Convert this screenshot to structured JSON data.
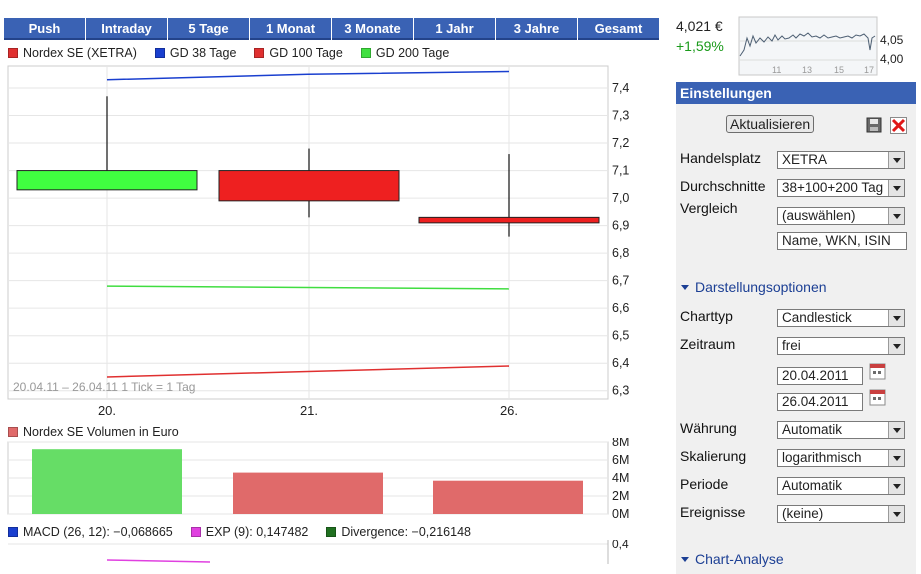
{
  "tabs": [
    "Push",
    "Intraday",
    "5 Tage",
    "1 Monat",
    "3 Monate",
    "1 Jahr",
    "3 Jahre",
    "Gesamt"
  ],
  "legend_main": [
    {
      "label": "Nordex SE (XETRA)",
      "color": "#e03030"
    },
    {
      "label": "GD 38 Tage",
      "color": "#1a3fcf"
    },
    {
      "label": "GD 100 Tage",
      "color": "#e03030"
    },
    {
      "label": "GD 200 Tage",
      "color": "#40e040"
    }
  ],
  "chart_data": [
    {
      "type": "candlestick",
      "series_name": "Nordex SE (XETRA)",
      "x": [
        "20.",
        "21.",
        "26."
      ],
      "candles": [
        {
          "open": 7.03,
          "high": 7.37,
          "low": 7.1,
          "close": 7.1,
          "color": "#40ff40"
        },
        {
          "open": 7.1,
          "high": 7.18,
          "low": 6.93,
          "close": 6.99,
          "color": "#ee2020"
        },
        {
          "open": 6.93,
          "high": 7.16,
          "low": 6.86,
          "close": 6.91,
          "color": "#ee2020"
        }
      ],
      "overlays": [
        {
          "name": "GD 38 Tage",
          "color": "#1a3fcf",
          "y": [
            7.43,
            7.45,
            7.46
          ]
        },
        {
          "name": "GD 100 Tage",
          "color": "#e03030",
          "y": [
            6.35,
            6.37,
            6.39
          ]
        },
        {
          "name": "GD 200 Tage",
          "color": "#40dd40",
          "y": [
            6.68,
            6.675,
            6.67
          ]
        }
      ],
      "yticks": [
        "7,4",
        "7,3",
        "7,2",
        "7,1",
        "7,0",
        "6,9",
        "6,8",
        "6,7",
        "6,6",
        "6,5",
        "6,4",
        "6,3"
      ],
      "ylim": [
        6.27,
        7.48
      ],
      "y_scale": "logarithmic",
      "grid": true,
      "range_note": "20.04.11 – 26.04.11",
      "tick_note": "1 Tick = 1 Tag"
    },
    {
      "type": "bar",
      "title": "Nordex SE Volumen in Euro",
      "categories": [
        "20.",
        "21.",
        "26."
      ],
      "values": [
        7.2,
        4.6,
        3.7
      ],
      "colors": [
        "#66dd66",
        "#e06a6a",
        "#e06a6a"
      ],
      "yticks": [
        "8M",
        "6M",
        "4M",
        "2M",
        "0M"
      ],
      "ylim": [
        0,
        8
      ]
    }
  ],
  "legend_volume": {
    "label": "Nordex SE Volumen in Euro",
    "color": "#e06a6a"
  },
  "legend_macd": [
    {
      "label": "MACD (26, 12): −0,068665",
      "color": "#1a3fcf"
    },
    {
      "label": "EXP (9): 0,147482",
      "color": "#e040e0"
    },
    {
      "label": "Divergence: −0,216148",
      "color": "#207020"
    }
  ],
  "macd_ytick": "0,4",
  "quote": {
    "price": "4,021 €",
    "change": "+1,59%",
    "change_color": "#1a9a1a"
  },
  "mini_chart": {
    "ticks_x": [
      "11",
      "13",
      "15",
      "17"
    ],
    "ticks_y": [
      "4,05",
      "4,00"
    ]
  },
  "panel": {
    "title": "Einstellungen",
    "refresh": "Aktualisieren",
    "handelsplatz_label": "Handelsplatz",
    "handelsplatz_value": "XETRA",
    "durchschnitte_label": "Durchschnitte",
    "durchschnitte_value": "38+100+200 Tag",
    "vergleich_label": "Vergleich",
    "vergleich_value": "(auswählen)",
    "vergleich_input": "Name, WKN, ISIN",
    "darstellung": "Darstellungsoptionen",
    "charttyp_label": "Charttyp",
    "charttyp_value": "Candlestick",
    "zeitraum_label": "Zeitraum",
    "zeitraum_value": "frei",
    "date_from": "20.04.2011",
    "date_to": "26.04.2011",
    "waehrung_label": "Währung",
    "waehrung_value": "Automatik",
    "skalierung_label": "Skalierung",
    "skalierung_value": "logarithmisch",
    "periode_label": "Periode",
    "periode_value": "Automatik",
    "ereignisse_label": "Ereignisse",
    "ereignisse_value": "(keine)",
    "chartanalyse": "Chart-Analyse"
  }
}
